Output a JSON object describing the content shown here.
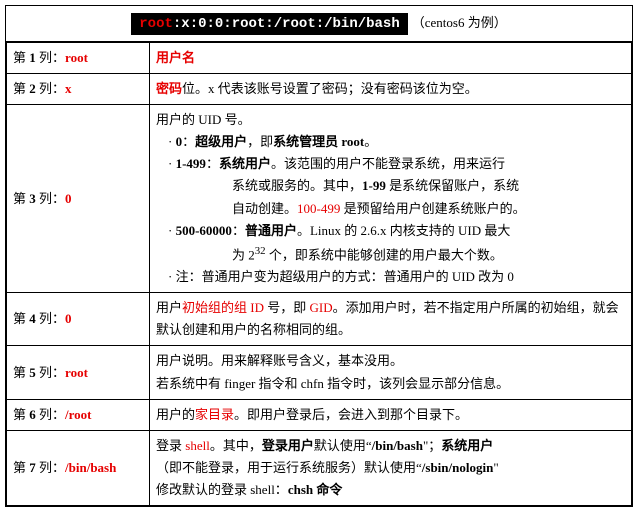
{
  "header": {
    "code_red": "root",
    "code_rest": ":x:0:0:root:/root:/bin/bash",
    "caption": "（centos6 为例）"
  },
  "rows": {
    "r1": {
      "pre": "第 ",
      "num": "1",
      "mid": " 列：",
      "val": "root"
    },
    "r2": {
      "pre": "第 ",
      "num": "2",
      "mid": " 列：",
      "val": "x"
    },
    "r3": {
      "pre": "第 ",
      "num": "3",
      "mid": " 列：",
      "val": "0"
    },
    "r4": {
      "pre": "第 ",
      "num": "4",
      "mid": " 列：",
      "val": "0"
    },
    "r5": {
      "pre": "第 ",
      "num": "5",
      "mid": " 列：",
      "val": "root"
    },
    "r6": {
      "pre": "第 ",
      "num": "6",
      "mid": " 列：",
      "val": "/root"
    },
    "r7": {
      "pre": "第 ",
      "num": "7",
      "mid": " 列：",
      "val": "/bin/bash"
    }
  },
  "desc": {
    "r1": {
      "t1": "用户名"
    },
    "r2": {
      "t1": "密码",
      "t2": "位。x 代表该账号设置了密码；没有密码该位为空。"
    },
    "r3": {
      "l1": "用户的 UID 号。",
      "l2a": "· ",
      "l2b": "0",
      "l2c": "：",
      "l2d": "超级用户",
      "l2e": "，即",
      "l2f": "系统管理员 root",
      "l2g": "。",
      "l3a": "· ",
      "l3b": "1-499",
      "l3c": "：",
      "l3d": "系统用户",
      "l3e": "。该范围的用户不能登录系统，用来运行",
      "l3f": "系统或服务的。其中，",
      "l3g": "1-99",
      "l3h": " 是系统保留账户，系统",
      "l3i": "自动创建。",
      "l3j": "100-499",
      "l3k": " 是预留给用户创建系统账户的。",
      "l4a": "· ",
      "l4b": "500-60000",
      "l4c": "：",
      "l4d": "普通用户",
      "l4e": "。Linux 的 2.6.x 内核支持的 UID 最大",
      "l4f": "为 2",
      "l4g": "32",
      "l4h": " 个，即系统中能够创建的用户最大个数。",
      "l5a": "· 注：普通用户变为超级用户的方式：普通用户的 UID 改为 0"
    },
    "r4": {
      "t1": "用户",
      "t2": "初始组的组 ID",
      "t3": " 号，即 ",
      "t4": "GID",
      "t5": "。添加用户时，若不指定用户所属的初始组，就会默认创建和用户的名称相同的组。"
    },
    "r5": {
      "t1": "用户说明。用来解释账号含义，基本没用。",
      "t2": "若系统中有 finger 指令和 chfn 指令时，该列会显示部分信息。"
    },
    "r6": {
      "t1": "用户的",
      "t2": "家目录",
      "t3": "。即用户登录后，会进入到那个目录下。"
    },
    "r7": {
      "t1": "登录 ",
      "t2": "shell",
      "t3": "。其中，",
      "t4": "登录用户",
      "t5": "默认使用“",
      "t6": "/bin/bash",
      "t7": "\"；",
      "t8": "系统用户",
      "t9": "（即不能登录，用于运行系统服务）默认使用“",
      "t10": "/sbin/nologin",
      "t11": "\"",
      "t12": "修改默认的登录 shell：",
      "t13": "chsh 命令"
    }
  }
}
